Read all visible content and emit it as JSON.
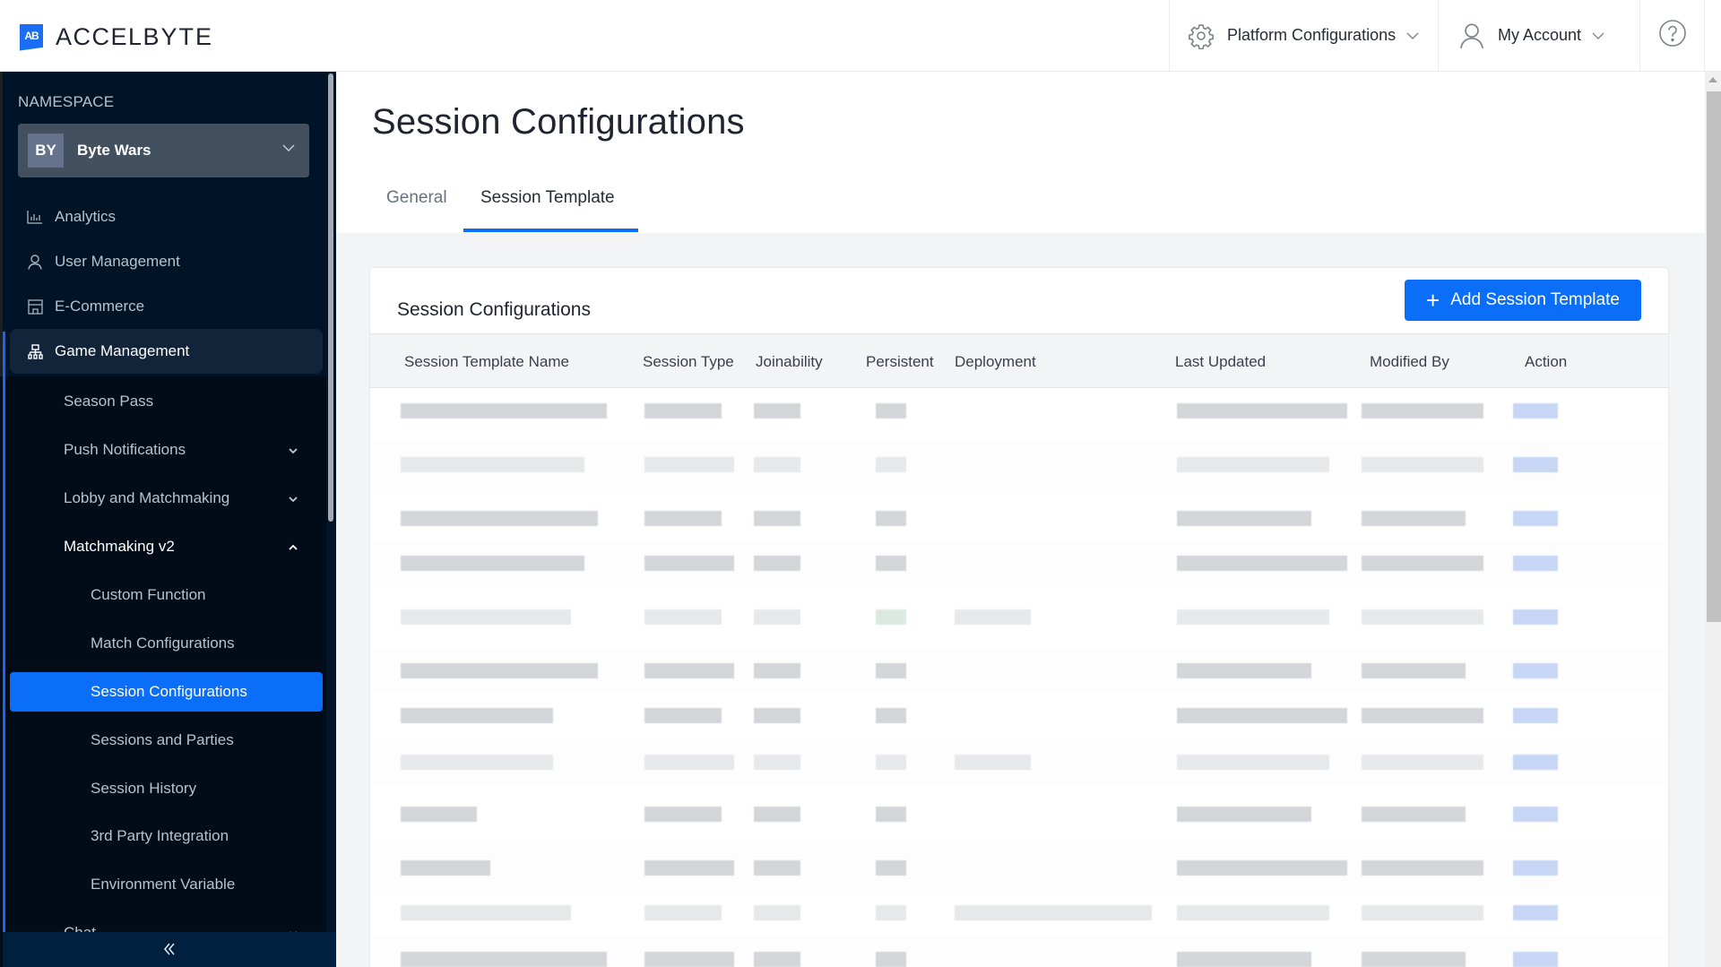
{
  "header": {
    "logo_mark": "AB",
    "logo_text_a": "ACCEL",
    "logo_text_b": "BYTE",
    "platform_configurations": "Platform Configurations",
    "my_account": "My Account",
    "help_icon": "help-circle-icon"
  },
  "sidebar": {
    "namespace_label": "NAMESPACE",
    "namespace": {
      "initials": "BY",
      "name": "Byte Wars"
    },
    "items": [
      {
        "label": "Analytics",
        "icon": "bar-chart-icon"
      },
      {
        "label": "User Management",
        "icon": "user-icon"
      },
      {
        "label": "E-Commerce",
        "icon": "store-icon"
      },
      {
        "label": "Game Management",
        "icon": "sitemap-icon",
        "active": true
      }
    ],
    "sub_items": [
      {
        "label": "Season Pass"
      },
      {
        "label": "Push Notifications",
        "expandable": true
      },
      {
        "label": "Lobby and Matchmaking",
        "expandable": true
      },
      {
        "label": "Matchmaking v2",
        "expandable": true,
        "expanded": true
      }
    ],
    "mm_v2_children": [
      {
        "label": "Custom Function"
      },
      {
        "label": "Match Configurations"
      },
      {
        "label": "Session Configurations",
        "selected": true
      },
      {
        "label": "Sessions and Parties"
      },
      {
        "label": "Session History"
      },
      {
        "label": "3rd Party Integration"
      },
      {
        "label": "Environment Variable"
      }
    ],
    "partial_item": {
      "label": "Chat",
      "expandable": true
    },
    "collapse_label": "«"
  },
  "main": {
    "page_title": "Session Configurations",
    "tabs": [
      {
        "label": "General",
        "active": false
      },
      {
        "label": "Session Template",
        "active": true
      }
    ],
    "card": {
      "title": "Session Configurations",
      "add_button": "Add Session Template",
      "columns": [
        "Session Template Name",
        "Session Type",
        "Joinability",
        "Persistent",
        "Deployment",
        "Last Updated",
        "Modified By",
        "Action"
      ],
      "rows_note": "Row contents are redacted (pixelated) in the screenshot",
      "visible_row_count": 12
    }
  },
  "colors": {
    "accent": "#0b6ef9",
    "sidebar_bg": "#001428",
    "submenu_bg": "#020c18",
    "page_bg": "#f3f4f6"
  }
}
